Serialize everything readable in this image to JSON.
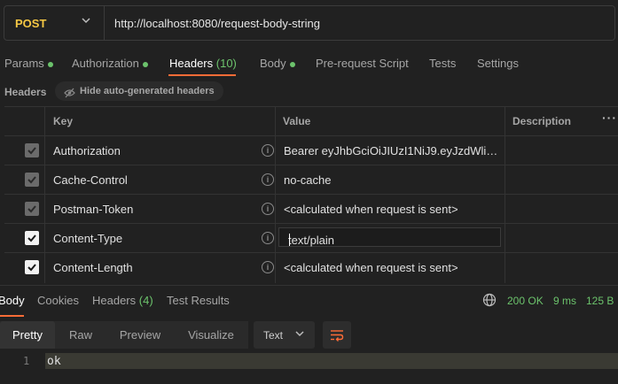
{
  "request": {
    "method": "POST",
    "url": "http://localhost:8080/request-body-string"
  },
  "request_tabs": [
    {
      "label": "Params",
      "dot": true
    },
    {
      "label": "Authorization",
      "dot": true
    },
    {
      "label": "Headers",
      "count": "(10)",
      "active": true
    },
    {
      "label": "Body",
      "dot": true
    },
    {
      "label": "Pre-request Script"
    },
    {
      "label": "Tests"
    },
    {
      "label": "Settings"
    }
  ],
  "headers_section": {
    "title": "Headers",
    "hide_auto_label": "Hide auto-generated headers"
  },
  "table": {
    "columns": {
      "key": "Key",
      "value": "Value",
      "description": "Description"
    },
    "rows": [
      {
        "key": "Authorization",
        "value": "Bearer eyJhbGciOiJIUzI1NiJ9.eyJzdWliOiJ...",
        "checked": true,
        "auto": true
      },
      {
        "key": "Cache-Control",
        "value": "no-cache",
        "checked": true,
        "auto": true
      },
      {
        "key": "Postman-Token",
        "value": "<calculated when request is sent>",
        "checked": true,
        "auto": true
      },
      {
        "key": "Content-Type",
        "value": "text/plain",
        "checked": true,
        "auto": false,
        "editing": true
      },
      {
        "key": "Content-Length",
        "value": "<calculated when request is sent>",
        "checked": true,
        "auto": false
      }
    ]
  },
  "response_tabs": [
    {
      "label": "Body",
      "active": true
    },
    {
      "label": "Cookies"
    },
    {
      "label": "Headers",
      "count": "(4)"
    },
    {
      "label": "Test Results"
    }
  ],
  "status": {
    "code": "200 OK",
    "time": "9 ms",
    "size": "125 B"
  },
  "view_tabs": [
    "Pretty",
    "Raw",
    "Preview",
    "Visualize"
  ],
  "format": {
    "selected": "Text"
  },
  "body": {
    "line_number": "1",
    "content": "ok"
  },
  "colors": {
    "accent": "#ff6c37",
    "method": "#f5c744",
    "success": "#6cc36c"
  }
}
